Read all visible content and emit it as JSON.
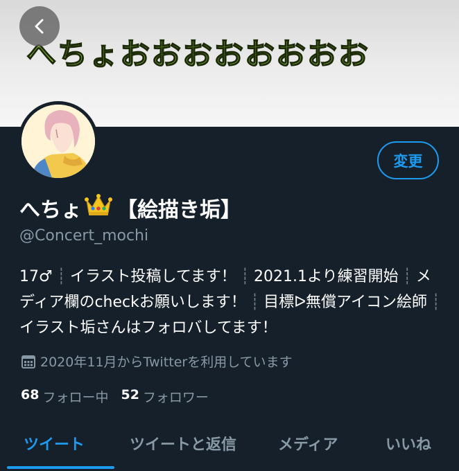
{
  "banner": {
    "text": "へちょおおおおおおおお"
  },
  "profile": {
    "edit_label": "変更",
    "name_prefix": "へちょ",
    "name_suffix": "【絵描き垢】",
    "handle": "@Concert_mochi",
    "bio": {
      "items": [
        "17♂",
        "イラスト投稿してます！",
        "2021.1より練習開始",
        "メディア欄のcheckお願いします！",
        "目標ᐅ無償アイコン絵師",
        "イラスト垢さんはフォロバしてます！"
      ]
    },
    "joined": "2020年11月からTwitterを利用しています",
    "following_count": "68",
    "following_label": "フォロー中",
    "followers_count": "52",
    "followers_label": "フォロワー"
  },
  "tabs": [
    "ツイート",
    "ツイートと返信",
    "メディア",
    "いいね"
  ],
  "colors": {
    "background": "#15202b",
    "accent": "#1d9bf0",
    "secondary_text": "#8899a6"
  },
  "icons": {
    "back": "chevron-left-icon",
    "calendar": "calendar-icon",
    "crown": "crown-emoji"
  }
}
